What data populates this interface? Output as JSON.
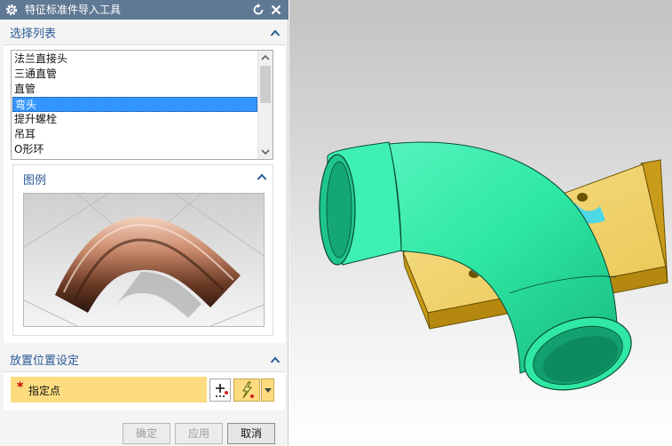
{
  "window": {
    "title": "特征标准件导入工具",
    "icons": {
      "app": "gear-icon",
      "reset": "reset-icon",
      "close": "close-icon"
    }
  },
  "selection_list": {
    "header": "选择列表",
    "items": [
      {
        "label": "法兰直接头",
        "selected": false
      },
      {
        "label": "三通直管",
        "selected": false
      },
      {
        "label": "直管",
        "selected": false
      },
      {
        "label": "弯头",
        "selected": true
      },
      {
        "label": "提升螺栓",
        "selected": false
      },
      {
        "label": "吊耳",
        "selected": false
      },
      {
        "label": "O形环",
        "selected": false
      }
    ]
  },
  "legend": {
    "header": "图例",
    "image": "pipe-elbow-preview"
  },
  "placement": {
    "header": "放置位置设定",
    "required_marker": "*",
    "point_label": "指定点",
    "icons": {
      "point": "point-constructor-icon",
      "infer": "inferred-point-icon",
      "dropdown": "dropdown-arrow-icon"
    }
  },
  "buttons": {
    "ok": "确定",
    "apply": "应用",
    "cancel": "取消"
  },
  "colors": {
    "title_bar": "#5f7893",
    "header_text": "#2a5a96",
    "selection": "#3396ff",
    "highlight_row": "#fddc80",
    "pipe": "#2ee8a3",
    "plate": "#f4d46a"
  }
}
